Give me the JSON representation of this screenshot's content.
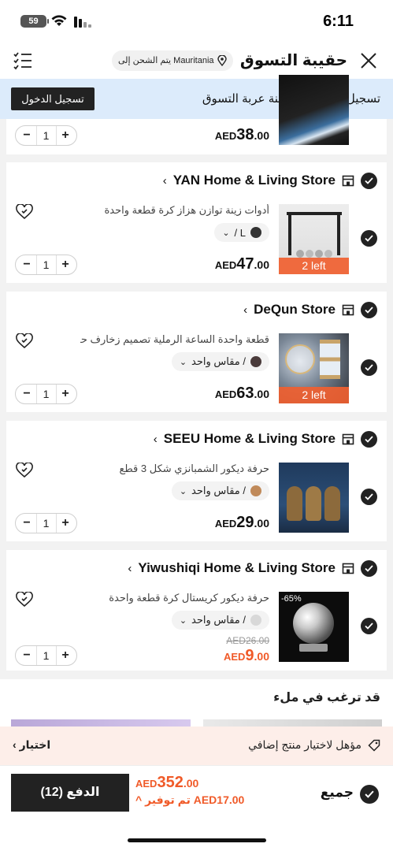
{
  "status_bar": {
    "time": "6:11",
    "battery": "59"
  },
  "header": {
    "title": "حقيبة التسوق",
    "ship_to": "Mauritania يتم الشحن إلى",
    "close_icon": "close-icon",
    "menu_icon": "list-menu-icon"
  },
  "login_banner": {
    "text": "تسجيل الدخول لمزامنة عربة التسوق",
    "button": "تسجيل الدخول"
  },
  "items": [
    {
      "store": "",
      "desc": "",
      "variant": "",
      "qty": "1",
      "price_cur": "AED",
      "price_int": "38",
      "price_dec": ".00"
    },
    {
      "store": "YAN Home & Living Store",
      "desc": "أدوات زينة توازن هزاز كرة قطعة واحدة",
      "variant": "L /",
      "swatch_color": "#333333",
      "badge": "2 left",
      "qty": "1",
      "price_cur": "AED",
      "price_int": "47",
      "price_dec": ".00"
    },
    {
      "store": "DeQun Store",
      "desc": "قطعة واحدة الساعة الرملية تصميم زخارف حدي...",
      "variant": "/ مقاس واحد",
      "swatch_color": "#4a3b3b",
      "badge": "2 left",
      "qty": "1",
      "price_cur": "AED",
      "price_int": "63",
      "price_dec": ".00"
    },
    {
      "store": "SEEU Home & Living Store",
      "desc": "حرفة ديكور الشمبانزي شكل 3 قطع",
      "variant": "/ مقاس واحد",
      "swatch_color": "#c08a5a",
      "qty": "1",
      "price_cur": "AED",
      "price_int": "29",
      "price_dec": ".00"
    },
    {
      "store": "Yiwushiqi Home & Living Store",
      "desc": "حرفة ديكور كريستال كرة قطعة واحدة",
      "variant": "/ مقاس واحد",
      "swatch_color": "#d8d8d8",
      "discount": "-65%",
      "old_price": "AED26.00",
      "qty": "1",
      "price_cur": "AED",
      "price_int": "9",
      "price_dec": ".00"
    }
  ],
  "recommend": {
    "title": "قد ترغب في ملء"
  },
  "addon": {
    "text": "مؤهل لاختيار منتج إضافي",
    "choose": "اختيار"
  },
  "bottom": {
    "all_label": "جميع",
    "total_cur": "AED",
    "total_int": "352",
    "total_dec": ".00",
    "save_text": "تم توفير AED17.00",
    "pay_button": "الدفع (12)"
  }
}
